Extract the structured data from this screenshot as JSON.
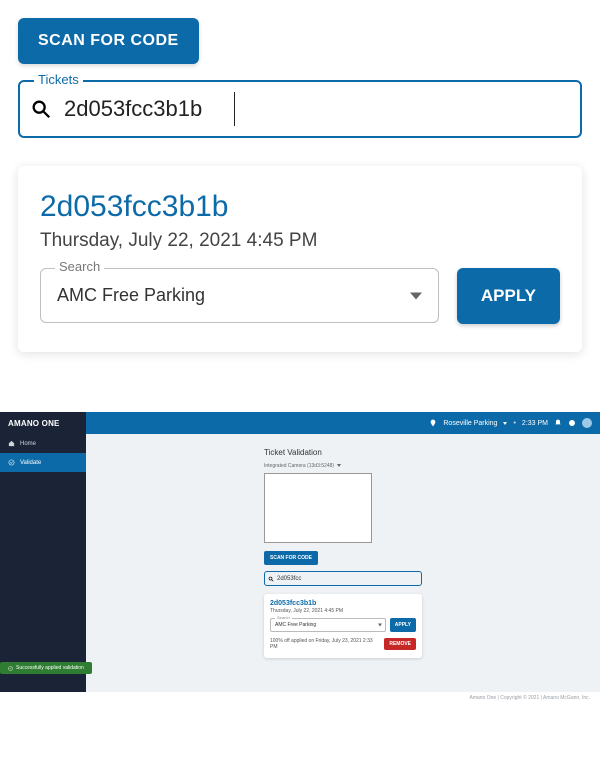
{
  "top": {
    "scan_label": "SCAN FOR CODE",
    "tickets_legend": "Tickets",
    "tickets_value": "2d053fcc3b1b"
  },
  "card": {
    "id": "2d053fcc3b1b",
    "date": "Thursday, July 22, 2021 4:45 PM",
    "search_legend": "Search",
    "search_value": "AMC Free Parking",
    "apply_label": "APPLY"
  },
  "app": {
    "brand": "AMANO ONE",
    "location": "Roseville Parking",
    "time": "2:33 PM",
    "sidebar": {
      "items": [
        {
          "label": "Home"
        },
        {
          "label": "Validate"
        }
      ]
    },
    "panel": {
      "title": "Ticket Validation",
      "camera": "Integrated Camera (13d3:5248)",
      "scan_label": "SCAN FOR CODE",
      "tickets_value": "2d053fcc",
      "card": {
        "id": "2d053fcc3b1b",
        "date": "Thursday, July 22, 2021 4:45 PM",
        "search_legend": "Search",
        "search_value": "AMC Free Parking",
        "apply_label": "APPLY",
        "applied_text": "100% off applied on Friday, July 23, 2021 2:33 PM",
        "remove_label": "REMOVE"
      }
    },
    "toast": "Successfully applied validation",
    "footer": "Amano One | Copyright © 2021 | Amano McGann, Inc."
  }
}
